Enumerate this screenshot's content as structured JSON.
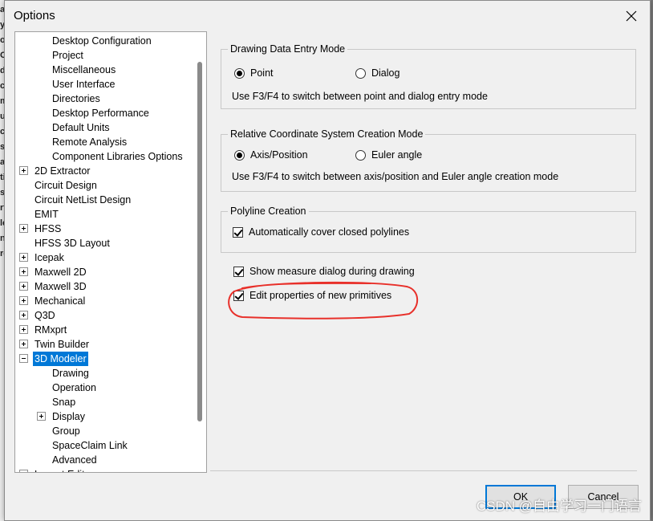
{
  "background_app": {
    "fragments": [
      "a",
      "y",
      "oc",
      "C",
      "d",
      "cc",
      "m",
      "ur",
      "cit",
      "s",
      "al",
      "tis",
      "su",
      "rt",
      "lc",
      "ndi",
      "ro"
    ]
  },
  "dialog": {
    "title": "Options"
  },
  "tree": {
    "items": [
      {
        "label": "Desktop Configuration",
        "level": 2,
        "expander": "none"
      },
      {
        "label": "Project",
        "level": 2,
        "expander": "none"
      },
      {
        "label": "Miscellaneous",
        "level": 2,
        "expander": "none"
      },
      {
        "label": "User Interface",
        "level": 2,
        "expander": "none"
      },
      {
        "label": "Directories",
        "level": 2,
        "expander": "none"
      },
      {
        "label": "Desktop Performance",
        "level": 2,
        "expander": "none"
      },
      {
        "label": "Default Units",
        "level": 2,
        "expander": "none"
      },
      {
        "label": "Remote Analysis",
        "level": 2,
        "expander": "none"
      },
      {
        "label": "Component Libraries Options",
        "level": 2,
        "expander": "none"
      },
      {
        "label": "2D Extractor",
        "level": 1,
        "expander": "plus"
      },
      {
        "label": "Circuit Design",
        "level": 1,
        "expander": "none"
      },
      {
        "label": "Circuit NetList Design",
        "level": 1,
        "expander": "none"
      },
      {
        "label": "EMIT",
        "level": 1,
        "expander": "none"
      },
      {
        "label": "HFSS",
        "level": 1,
        "expander": "plus"
      },
      {
        "label": "HFSS 3D Layout",
        "level": 1,
        "expander": "none"
      },
      {
        "label": "Icepak",
        "level": 1,
        "expander": "plus"
      },
      {
        "label": "Maxwell 2D",
        "level": 1,
        "expander": "plus"
      },
      {
        "label": "Maxwell 3D",
        "level": 1,
        "expander": "plus"
      },
      {
        "label": "Mechanical",
        "level": 1,
        "expander": "plus"
      },
      {
        "label": "Q3D",
        "level": 1,
        "expander": "plus"
      },
      {
        "label": "RMxprt",
        "level": 1,
        "expander": "plus"
      },
      {
        "label": "Twin Builder",
        "level": 1,
        "expander": "plus"
      },
      {
        "label": "3D Modeler",
        "level": 1,
        "expander": "minus",
        "selected": true
      },
      {
        "label": "Drawing",
        "level": 2,
        "expander": "none"
      },
      {
        "label": "Operation",
        "level": 2,
        "expander": "none"
      },
      {
        "label": "Snap",
        "level": 2,
        "expander": "none"
      },
      {
        "label": "Display",
        "level": 2,
        "expander": "plus"
      },
      {
        "label": "Group",
        "level": 2,
        "expander": "none"
      },
      {
        "label": "SpaceClaim Link",
        "level": 2,
        "expander": "none"
      },
      {
        "label": "Advanced",
        "level": 2,
        "expander": "none"
      },
      {
        "label": "Layout Editor",
        "level": 1,
        "expander": "plus"
      }
    ]
  },
  "drawing_data_entry": {
    "title": "Drawing Data Entry Mode",
    "option_point": "Point",
    "option_dialog": "Dialog",
    "selected": "Point",
    "hint": "Use F3/F4 to switch between point and dialog entry mode"
  },
  "relative_cs": {
    "title": "Relative Coordinate System Creation Mode",
    "option_axis": "Axis/Position",
    "option_euler": "Euler angle",
    "selected": "Axis/Position",
    "hint": "Use F3/F4 to switch between axis/position and Euler angle creation mode"
  },
  "polyline": {
    "title": "Polyline Creation",
    "auto_cover_label": "Automatically cover closed polylines",
    "auto_cover_checked": true
  },
  "show_measure": {
    "label": "Show measure dialog during drawing",
    "checked": true
  },
  "edit_properties": {
    "label": "Edit properties of new primitives",
    "checked": true
  },
  "buttons": {
    "ok": "OK",
    "cancel": "Cancel"
  },
  "annotation_color": "#e8302a",
  "selection_color": "#0078d7",
  "watermark": "CSDN @自由学习一门语言"
}
